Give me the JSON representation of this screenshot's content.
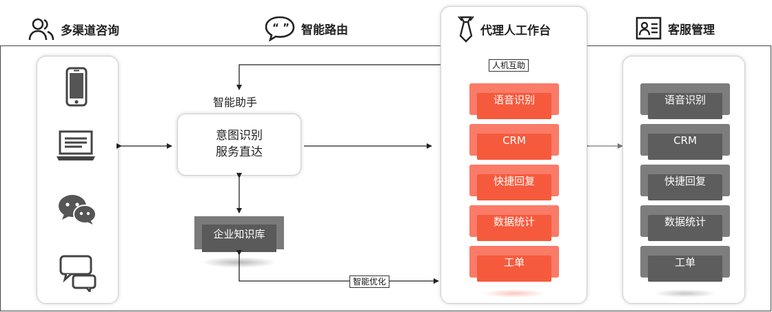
{
  "headers": {
    "multichannel": "多渠道咨询",
    "routing": "智能路由",
    "agent_workbench": "代理人工作台",
    "service_mgmt": "客服管理"
  },
  "assistant": {
    "title": "智能助手",
    "line1": "意图识别",
    "line2": "服务直达"
  },
  "knowledge_base": "企业知识库",
  "tags": {
    "human_machine": "人机互助",
    "smart_optimize": "智能优化"
  },
  "agent_modules": [
    "语音识别",
    "CRM",
    "快捷回复",
    "数据统计",
    "工单"
  ],
  "service_modules": [
    "语音识别",
    "CRM",
    "快捷回复",
    "数据统计",
    "工单"
  ],
  "colors": {
    "agent_module": "#f65a3d",
    "service_module": "#5d5d5d"
  },
  "channel_icons": [
    "mobile-phone-icon",
    "laptop-icon",
    "wechat-icon",
    "chat-bubbles-icon"
  ]
}
